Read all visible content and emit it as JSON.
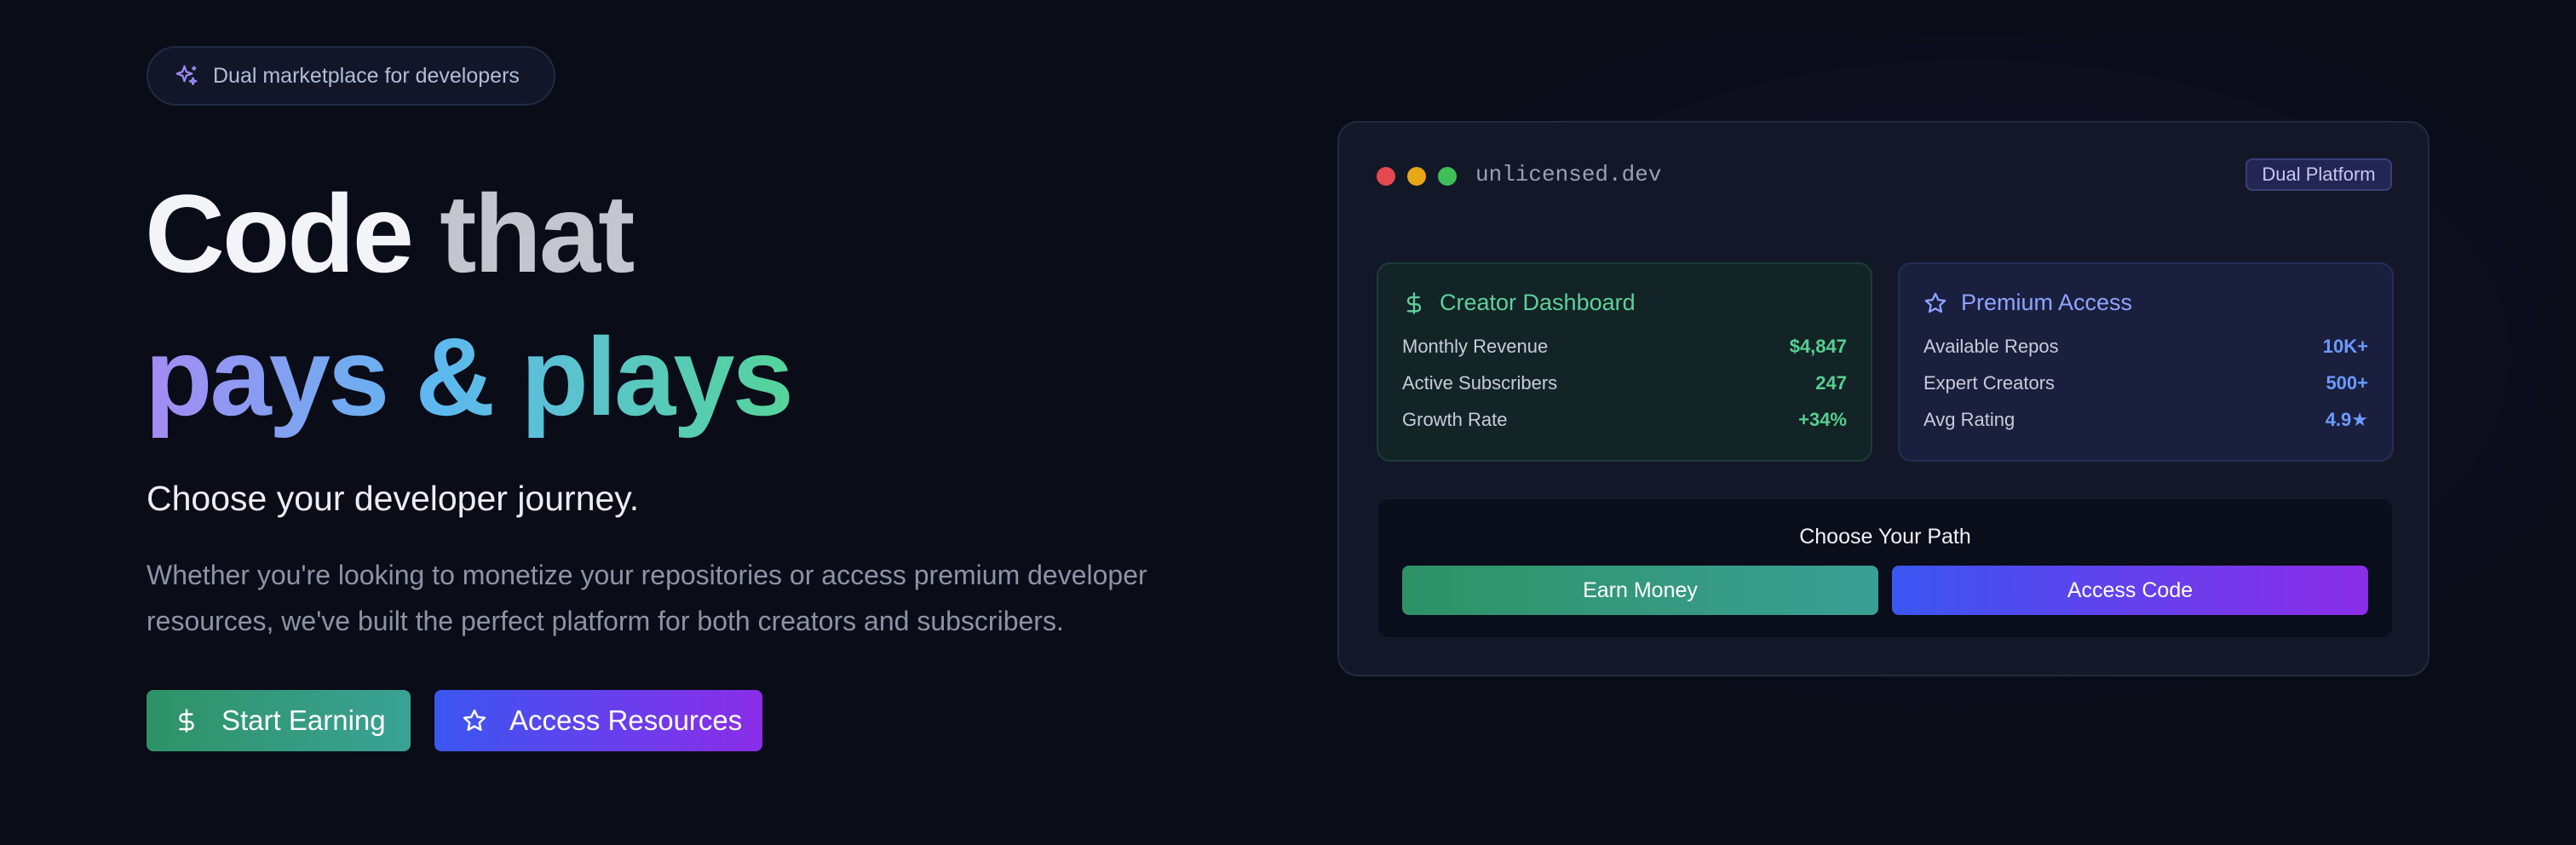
{
  "hero": {
    "badge_text": "Dual marketplace for developers",
    "headline_word1": "Code",
    "headline_word2": "that",
    "headline_line2": "pays & plays",
    "subtitle": "Choose your developer journey.",
    "paragraph": "Whether you're looking to monetize your repositories or access premium developer resources, we've built the perfect platform for both creators and subscribers.",
    "cta_primary": "Start Earning",
    "cta_secondary": "Access Resources"
  },
  "preview": {
    "domain": "unlicensed.dev",
    "platform_badge": "Dual Platform",
    "creator_panel": {
      "title": "Creator Dashboard",
      "rows": [
        {
          "label": "Monthly Revenue",
          "value": "$4,847"
        },
        {
          "label": "Active Subscribers",
          "value": "247"
        },
        {
          "label": "Growth Rate",
          "value": "+34%"
        }
      ]
    },
    "premium_panel": {
      "title": "Premium Access",
      "rows": [
        {
          "label": "Available Repos",
          "value": "10K+"
        },
        {
          "label": "Expert Creators",
          "value": "500+"
        },
        {
          "label": "Avg Rating",
          "value": "4.9★"
        }
      ]
    },
    "choose_path": {
      "title": "Choose Your Path",
      "earn_button": "Earn Money",
      "access_button": "Access Code"
    }
  },
  "icons": {
    "badge": "sparkles-icon",
    "earn": "dollar-icon",
    "access": "star-icon",
    "window_dots": [
      "#e5484d",
      "#e8a717",
      "#3fbf5a"
    ]
  },
  "colors": {
    "background": "#0a0c18",
    "green_accent": "#58cf8f",
    "blue_accent": "#6b9bff",
    "purple_accent": "#8b2de8"
  }
}
